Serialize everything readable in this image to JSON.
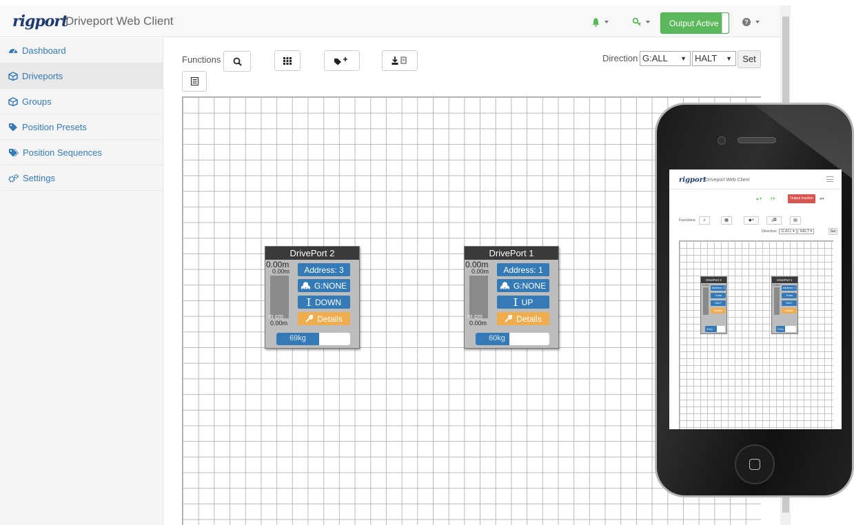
{
  "header": {
    "logo": "rigport",
    "title": "Driveport Web Client",
    "output_label": "Output Active",
    "colors": {
      "success": "#5cb85c",
      "primary": "#337ab7",
      "warning": "#f0ad4e",
      "danger": "#d9534f"
    },
    "icons": [
      "bell-icon",
      "key-icon",
      "help-icon"
    ]
  },
  "sidebar": {
    "items": [
      {
        "label": "Dashboard",
        "icon": "dashboard-icon"
      },
      {
        "label": "Driveports",
        "icon": "cube-icon"
      },
      {
        "label": "Groups",
        "icon": "cube-icon"
      },
      {
        "label": "Position Presets",
        "icon": "tag-icon"
      },
      {
        "label": "Position Sequences",
        "icon": "tags-icon"
      },
      {
        "label": "Settings",
        "icon": "cogs-icon"
      }
    ],
    "active_index": 1
  },
  "toolbar": {
    "functions_label": "Functions",
    "direction_label": "Direction",
    "group_value": "G:ALL",
    "mode_value": "HALT",
    "set_label": "Set"
  },
  "driveports": [
    {
      "title": "DrivePort 2",
      "pos_top_big": "0.00m",
      "pos_top_small": "0.00m",
      "units": "m  cm",
      "pos_bottom": "0.00m",
      "address": "Address: 3",
      "group": "G:NONE",
      "direction": "DOWN",
      "details": "Details",
      "weight": "69kg",
      "weight_fraction": 0.58
    },
    {
      "title": "DrivePort 1",
      "pos_top_big": "0.00m",
      "pos_top_small": "0.00m",
      "units": "m  cm",
      "pos_bottom": "0.00m",
      "address": "Address: 1",
      "group": "G:NONE",
      "direction": "UP",
      "details": "Details",
      "weight": "60kg",
      "weight_fraction": 0.46
    }
  ],
  "mobile": {
    "logo": "rigport",
    "title": "Driveport Web Client",
    "output_label": "Output Inactive",
    "functions_label": "Functions",
    "direction_label": "Direction",
    "group_value": "G:ALL",
    "mode_value": "HALT",
    "set_label": "Set",
    "driveports": [
      {
        "title": "DrivePort 2",
        "pos": "0.00m",
        "address": "Address: 3",
        "group": "Truss",
        "direction": "HALT",
        "details": "Details",
        "weight": "69kg"
      },
      {
        "title": "DrivePort 1",
        "pos": "0.00m",
        "address": "Address: 1",
        "group": "Truss",
        "direction": "HALT",
        "details": "Details",
        "weight": "60kg"
      }
    ]
  }
}
